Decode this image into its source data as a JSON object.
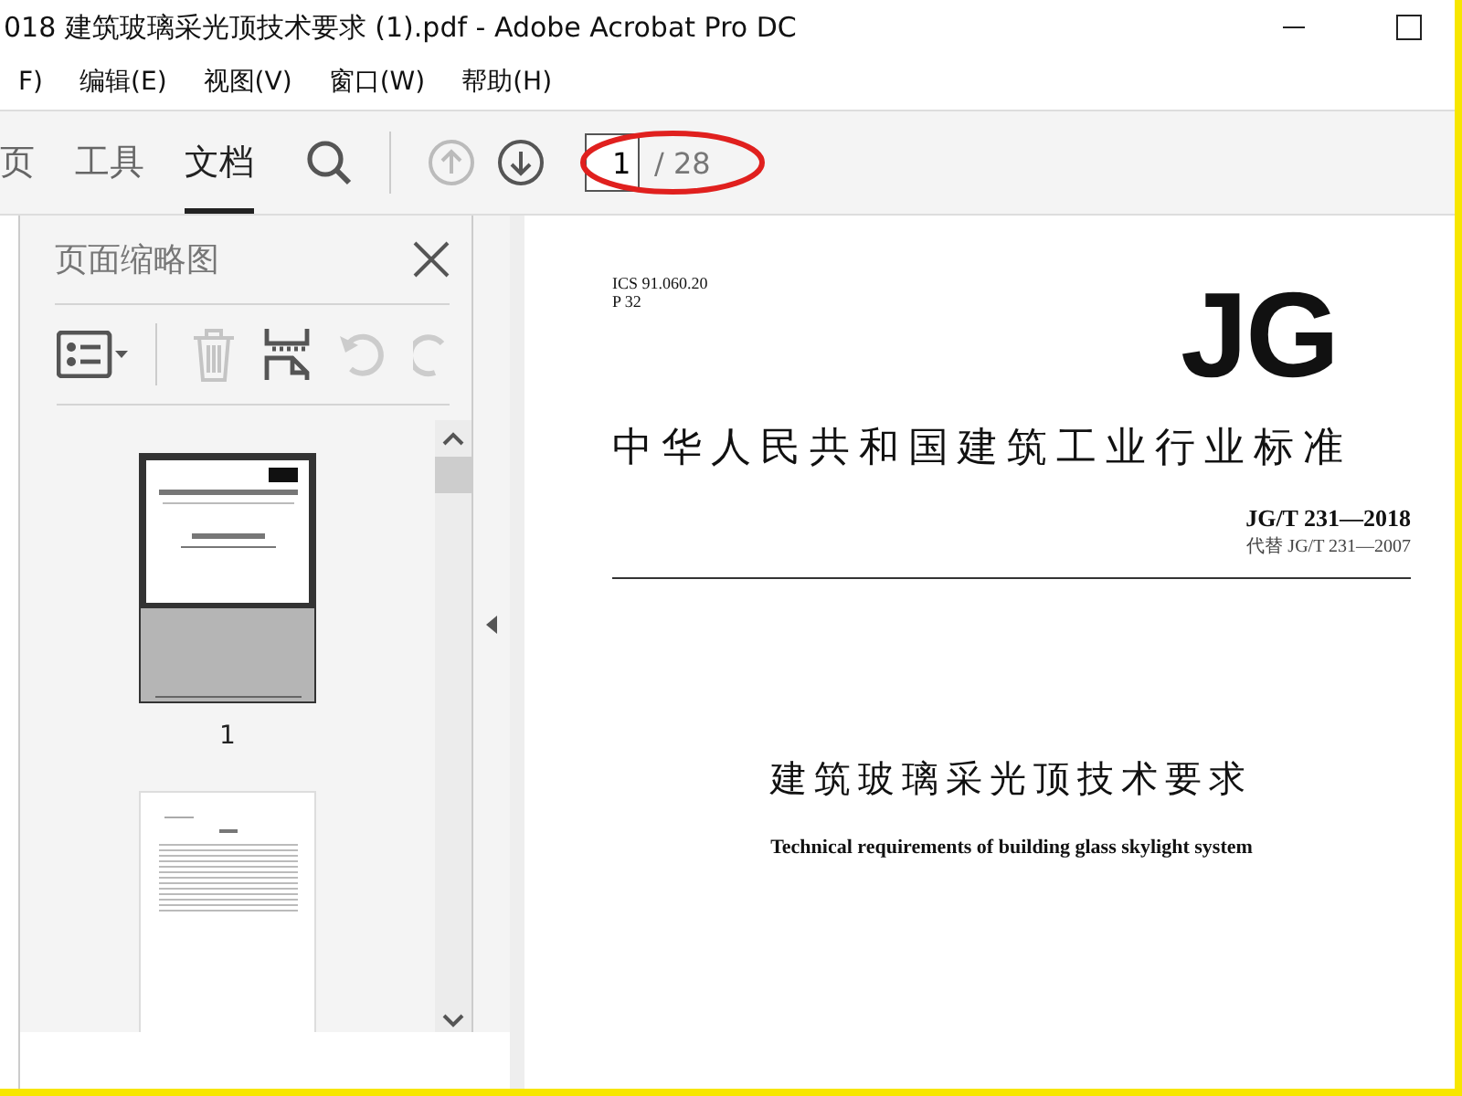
{
  "window": {
    "title": "018 建筑玻璃采光顶技术要求 (1).pdf - Adobe Acrobat Pro DC"
  },
  "menu": [
    "F)",
    "编辑(E)",
    "视图(V)",
    "窗口(W)",
    "帮助(H)"
  ],
  "tabs": [
    {
      "label": "页",
      "selected": false
    },
    {
      "label": "工具",
      "selected": false
    },
    {
      "label": "文档",
      "selected": true
    }
  ],
  "page_nav": {
    "up_disabled": true,
    "value": "1",
    "total": "/ 28"
  },
  "thumbnails_panel": {
    "title": "页面缩略图",
    "pages": [
      {
        "label": "1",
        "selected": true
      },
      {
        "selected": false
      }
    ]
  },
  "document": {
    "ics": "ICS 91.060.20",
    "class_code": "P 32",
    "logo": "JG",
    "header": "中华人民共和国建筑工业行业标准",
    "number": "JG/T 231—2018",
    "replaces": "代替 JG/T 231—2007",
    "title": "建筑玻璃采光顶技术要求",
    "subtitle": "Technical requirements of building glass skylight system"
  }
}
